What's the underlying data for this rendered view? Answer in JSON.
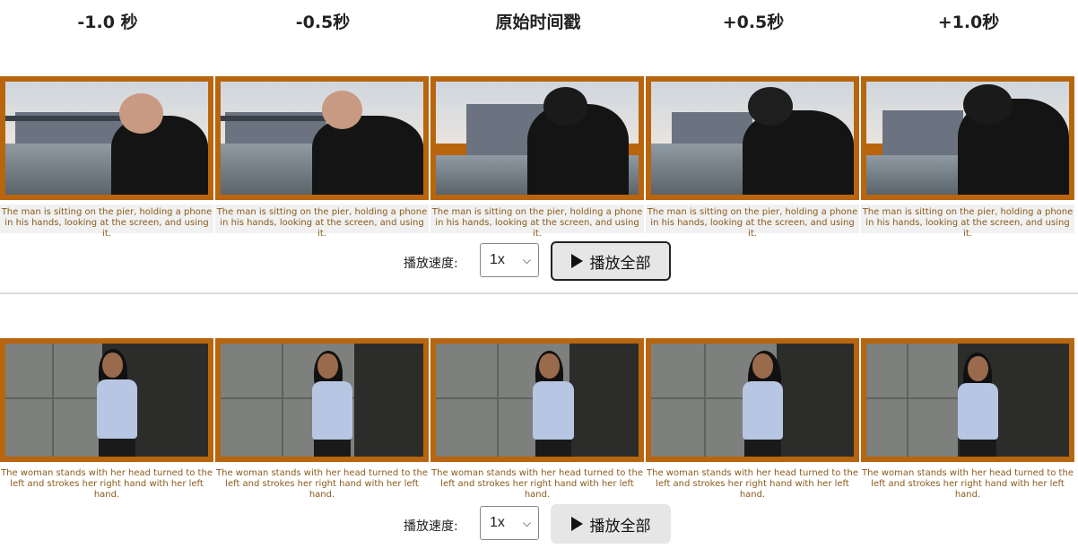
{
  "headers": [
    "-1.0 秒",
    "-0.5秒",
    "原始时间戳",
    "+0.5秒",
    "+1.0秒"
  ],
  "row1": {
    "captions": [
      "The man is sitting on the pier, holding a phone in his hands, looking at the screen, and using it.",
      "The man is sitting on the pier, holding a phone in his hands, looking at the screen, and using it.",
      "The man is sitting on the pier, holding a phone in his hands, looking at the screen, and using it.",
      "The man is sitting on the pier, holding a phone in his hands, looking at the screen, and using it.",
      "The man is sitting on the pier, holding a phone in his hands, looking at the screen, and using it."
    ],
    "speed_label": "播放速度:",
    "speed_value": "1x",
    "play_all": "播放全部"
  },
  "row2": {
    "captions": [
      "The woman stands with her head turned to the left and strokes her right hand with her left hand.",
      "The woman stands with her head turned to the left and strokes her right hand with her left hand.",
      "The woman stands with her head turned to the left and strokes her right hand with her left hand.",
      "The woman stands with her head turned to the left and strokes her right hand with her left hand.",
      "The woman stands with her head turned to the left and strokes her right hand with her left hand."
    ],
    "speed_label": "播放速度:",
    "speed_value": "1x",
    "play_all": "播放全部"
  },
  "colors": {
    "frame_border": "#b8650e",
    "caption_text": "#8a5a1a"
  },
  "icons": [
    "play-icon",
    "chevron-down-icon"
  ]
}
